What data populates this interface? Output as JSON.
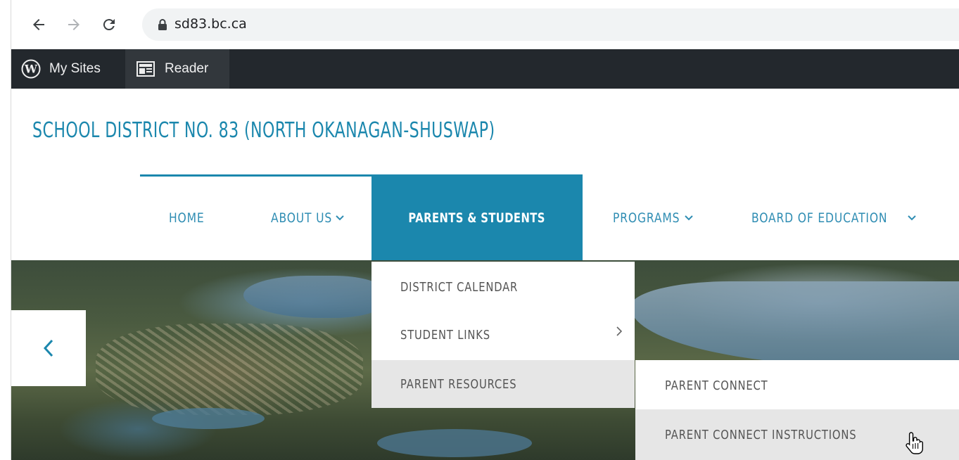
{
  "browser": {
    "back_icon": "arrow-left-icon",
    "forward_icon": "arrow-right-icon",
    "reload_icon": "reload-icon",
    "lock_icon": "lock-icon",
    "url": "sd83.bc.ca"
  },
  "adminbar": {
    "my_sites_label": "My Sites",
    "reader_label": "Reader",
    "bg_color": "#23282d"
  },
  "site": {
    "title": "SCHOOL DISTRICT NO. 83 (NORTH OKANAGAN-SHUSWAP)",
    "accent_color": "#1b87ad"
  },
  "nav": {
    "items": [
      {
        "label": "HOME"
      },
      {
        "label": "ABOUT US",
        "icon": "chevron-down-icon"
      },
      {
        "label": "PARENTS & STUDENTS",
        "active": true
      },
      {
        "label": "PROGRAMS",
        "icon": "chevron-down-icon"
      },
      {
        "label": "BOARD OF EDUCATION",
        "icon": "chevron-down-icon"
      }
    ]
  },
  "dropdown": {
    "items": [
      {
        "label": "DISTRICT CALENDAR"
      },
      {
        "label": "STUDENT LINKS",
        "icon": "chevron-right-icon"
      },
      {
        "label": "PARENT RESOURCES",
        "highlighted": true
      }
    ]
  },
  "submenu": {
    "items": [
      {
        "label": "PARENT CONNECT"
      },
      {
        "label": "PARENT CONNECT INSTRUCTIONS",
        "highlighted": true
      }
    ]
  },
  "slider": {
    "prev_icon": "chevron-left-icon"
  },
  "cursor": "hand-pointer-icon"
}
